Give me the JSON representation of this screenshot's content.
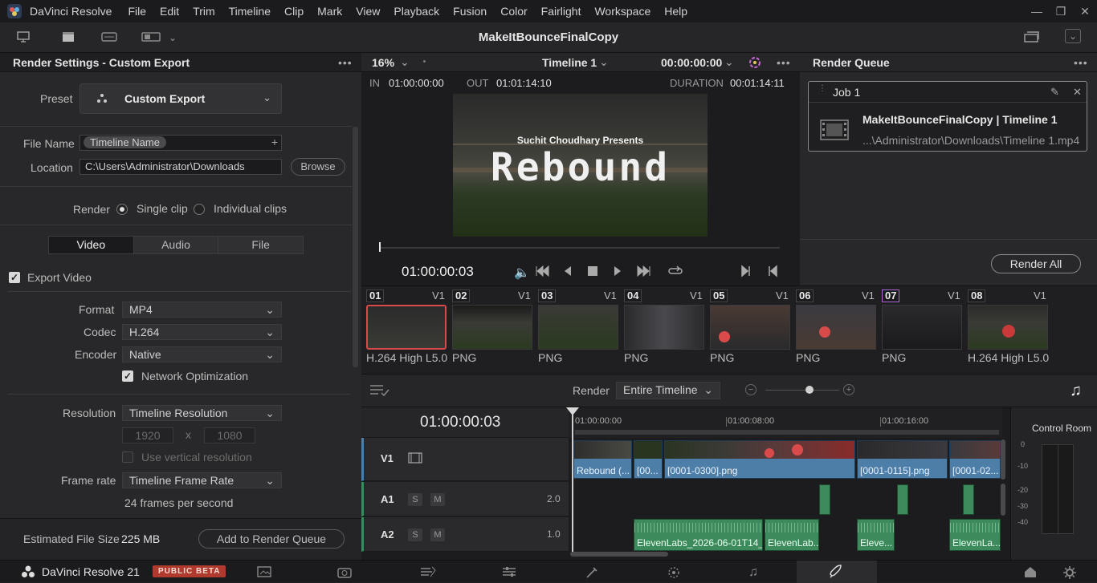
{
  "menubar": {
    "app_name": "DaVinci Resolve",
    "items": [
      "File",
      "Edit",
      "Trim",
      "Timeline",
      "Clip",
      "Mark",
      "View",
      "Playback",
      "Fusion",
      "Color",
      "Fairlight",
      "Workspace",
      "Help"
    ]
  },
  "toolbar": {
    "project_title": "MakeItBounceFinalCopy"
  },
  "render_settings": {
    "title": "Render Settings - Custom Export",
    "preset_label": "Preset",
    "preset_value": "Custom Export",
    "file_name_label": "File Name",
    "file_name_token": "Timeline Name",
    "location_label": "Location",
    "location_value": "C:\\Users\\Administrator\\Downloads",
    "browse_label": "Browse",
    "render_label": "Render",
    "single_clip": "Single clip",
    "individual_clips": "Individual clips",
    "tabs": [
      "Video",
      "Audio",
      "File"
    ],
    "export_video": "Export Video",
    "format_label": "Format",
    "format_value": "MP4",
    "codec_label": "Codec",
    "codec_value": "H.264",
    "encoder_label": "Encoder",
    "encoder_value": "Native",
    "network_opt": "Network Optimization",
    "resolution_label": "Resolution",
    "resolution_value": "Timeline Resolution",
    "width": "1920",
    "x_sep": "x",
    "height": "1080",
    "vertical_res": "Use vertical resolution",
    "framerate_label": "Frame rate",
    "framerate_value": "Timeline Frame Rate",
    "fps_text": "24 frames per second",
    "est_size_label": "Estimated File Size",
    "est_size_value": "225 MB",
    "add_queue": "Add to Render Queue"
  },
  "viewer": {
    "zoom": "16%",
    "timeline_name": "Timeline 1",
    "timecode": "00:00:00:00",
    "in_label": "IN",
    "in_value": "01:00:00:00",
    "out_label": "OUT",
    "out_value": "01:01:14:10",
    "duration_label": "DURATION",
    "duration_value": "00:01:14:11",
    "frame_title_small": "Suchit Choudhary Presents",
    "frame_title_big": "Rebound",
    "current_tc": "01:00:00:03"
  },
  "render_queue": {
    "title": "Render Queue",
    "job_name": "Job 1",
    "job_title": "MakeItBounceFinalCopy | Timeline 1",
    "job_path": "...\\Administrator\\Downloads\\Timeline 1.mp4",
    "render_all": "Render All"
  },
  "clips": [
    {
      "num": "01",
      "track": "V1",
      "caption": "H.264 High L5.0"
    },
    {
      "num": "02",
      "track": "V1",
      "caption": "PNG"
    },
    {
      "num": "03",
      "track": "V1",
      "caption": "PNG"
    },
    {
      "num": "04",
      "track": "V1",
      "caption": "PNG"
    },
    {
      "num": "05",
      "track": "V1",
      "caption": "PNG"
    },
    {
      "num": "06",
      "track": "V1",
      "caption": "PNG"
    },
    {
      "num": "07",
      "track": "V1",
      "caption": "PNG"
    },
    {
      "num": "08",
      "track": "V1",
      "caption": "H.264 High L5.0"
    }
  ],
  "render_bar": {
    "render_label": "Render",
    "render_value": "Entire Timeline"
  },
  "timeline": {
    "timecode": "01:00:00:03",
    "ruler": [
      "01:00:00:00",
      "01:00:08:00",
      "01:00:16:00"
    ],
    "tracks": [
      {
        "name": "V1"
      },
      {
        "name": "A1",
        "level": "2.0"
      },
      {
        "name": "A2",
        "level": "1.0"
      }
    ],
    "s_label": "S",
    "m_label": "M",
    "video_clips": [
      "Rebound (...",
      "[00...",
      "[0001-0300].png",
      "[0001-0115].png",
      "[0001-02..."
    ],
    "audio_clips": [
      "ElevenLabs_2026-06-01T14_...",
      "ElevenLab...",
      "Eleve...",
      "ElevenLa..."
    ]
  },
  "control_room": {
    "title": "Control Room",
    "scale": [
      "0",
      "-10",
      "-20",
      "-30",
      "-40"
    ]
  },
  "bottombar": {
    "app_name": "DaVinci Resolve 21",
    "badge": "PUBLIC BETA"
  },
  "colors": {
    "accent_red": "#d94b4b",
    "video_clip": "#4d7ea8",
    "audio_clip": "#3d8a5c",
    "badge_bg": "#b03a2e"
  }
}
